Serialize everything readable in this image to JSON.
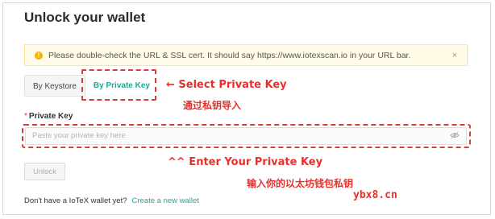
{
  "page": {
    "title": "Unlock your wallet"
  },
  "banner": {
    "icon": "warning-icon",
    "text": "Please double-check the URL & SSL cert. It should say https://www.iotexscan.io in your URL bar.",
    "close": "×"
  },
  "tabs": [
    {
      "label": "By Keystore",
      "active": false
    },
    {
      "label": "By Private Key",
      "active": true
    }
  ],
  "annotations": {
    "select": "← Select Private Key",
    "select_cn": "通过私钥导入",
    "enter": "^^ Enter Your Private Key",
    "enter_cn": "输入你的以太坊钱包私钥"
  },
  "form": {
    "required_mark": "*",
    "label": "Private Key",
    "placeholder": "Paste your private key here",
    "unlock_label": "Unlock"
  },
  "footer": {
    "text": "Don't have a IoTeX wallet yet?",
    "link": "Create a new wallet"
  },
  "watermark": "ybx8.cn",
  "colors": {
    "accent": "#1ea79a",
    "annotation": "#e8302b",
    "banner_bg": "#fffbe6"
  }
}
